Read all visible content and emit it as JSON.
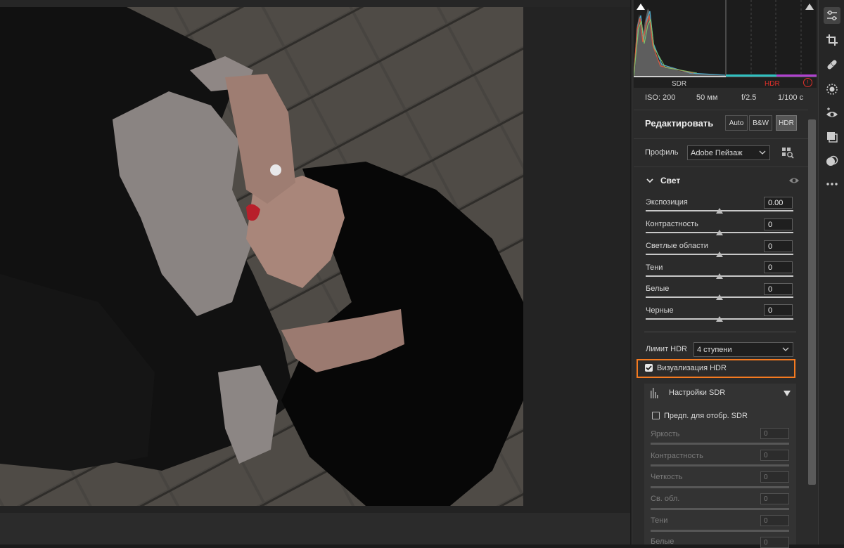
{
  "histogram": {
    "sdr_label": "SDR",
    "hdr_label": "HDR",
    "warning_icon": "clipping-warning-icon"
  },
  "exif": {
    "iso": "ISO: 200",
    "focal": "50 мм",
    "aperture": "f/2.5",
    "shutter": "1/100 с"
  },
  "edit": {
    "title": "Редактировать",
    "buttons": [
      "Auto",
      "B&W",
      "HDR"
    ],
    "active_button": "HDR"
  },
  "profile": {
    "label": "Профиль",
    "value": "Adobe Пейзаж"
  },
  "light": {
    "title": "Свет",
    "sliders": [
      {
        "label": "Экспозиция",
        "value": "0.00"
      },
      {
        "label": "Контрастность",
        "value": "0"
      },
      {
        "label": "Светлые области",
        "value": "0"
      },
      {
        "label": "Тени",
        "value": "0"
      },
      {
        "label": "Белые",
        "value": "0"
      },
      {
        "label": "Черные",
        "value": "0"
      }
    ]
  },
  "hdr_limit": {
    "label": "Лимит HDR",
    "value": "4 ступени"
  },
  "hdr_visualize": {
    "label": "Визуализация HDR",
    "checked": true
  },
  "sdr_settings": {
    "title": "Настройки SDR",
    "preview_label": "Предп. для отобр. SDR",
    "preview_checked": false,
    "sliders": [
      {
        "label": "Яркость",
        "value": "0"
      },
      {
        "label": "Контрастность",
        "value": "0"
      },
      {
        "label": "Четкость",
        "value": "0"
      },
      {
        "label": "Св. обл.",
        "value": "0"
      },
      {
        "label": "Тени",
        "value": "0"
      },
      {
        "label": "Белые",
        "value": "0"
      }
    ]
  },
  "toolstrip": [
    "edit-sliders-icon",
    "crop-icon",
    "healing-icon",
    "masking-icon",
    "red-eye-icon",
    "presets-icon",
    "snapshots-icon",
    "more-icon"
  ],
  "colors": {
    "highlight": "#f47a20",
    "hdr_red": "#e0302a",
    "panel_bg": "#2b2b2b"
  }
}
